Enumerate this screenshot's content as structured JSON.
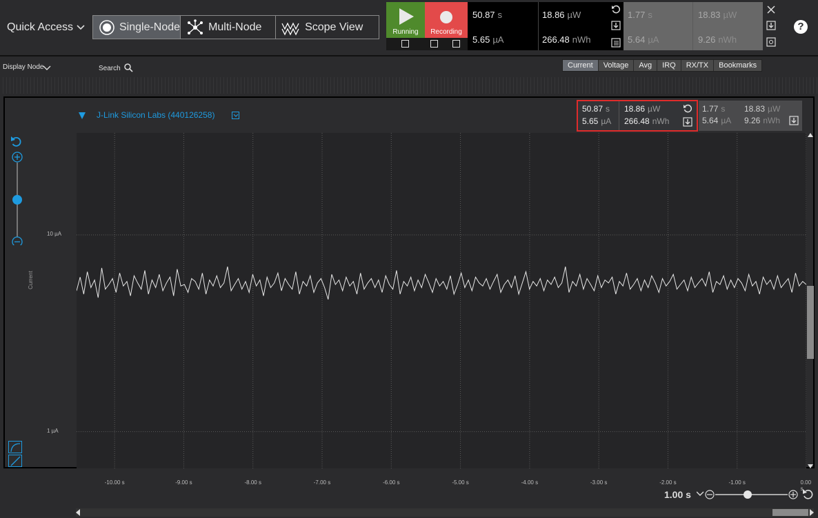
{
  "toolbar": {
    "quick_access": "Quick Access",
    "modes": [
      {
        "label": "Single-Node",
        "icon": "single-node-icon",
        "active": true
      },
      {
        "label": "Multi-Node",
        "icon": "multi-node-icon",
        "active": false
      },
      {
        "label": "Scope View",
        "icon": "scope-view-icon",
        "active": false
      }
    ],
    "running_label": "Running",
    "recording_label": "Recording",
    "help": "?"
  },
  "measurements": {
    "time": "50.87",
    "time_unit": "s",
    "current": "5.65",
    "current_unit": "µA",
    "power": "18.86",
    "power_unit": "µW",
    "energy": "266.48",
    "energy_unit": "nWh"
  },
  "measurements_selection": {
    "time": "1.77",
    "time_unit": "s",
    "current": "5.64",
    "current_unit": "µA",
    "power": "18.83",
    "power_unit": "µW",
    "energy": "9.26",
    "energy_unit": "nWh"
  },
  "bar2": {
    "display_node": "Display Node",
    "search": "Search",
    "tabs": [
      "Current",
      "Voltage",
      "Avg",
      "IRQ",
      "RX/TX",
      "Bookmarks"
    ],
    "active_tab": "Current"
  },
  "node": {
    "name": "J-Link Silicon Labs (440126258)"
  },
  "chart_data": {
    "type": "line",
    "ylabel": "Current",
    "yticks": [
      "10 µA",
      "1 µA"
    ],
    "ytick_values": [
      10,
      1
    ],
    "yscale": "log",
    "xticks": [
      "-10.00 s",
      "-9.00 s",
      "-8.00 s",
      "-7.00 s",
      "-6.00 s",
      "-5.00 s",
      "-4.00 s",
      "-3.00 s",
      "-2.00 s",
      "-1.00 s",
      "0.00 s"
    ],
    "xlim": [
      -10.55,
      0
    ],
    "ylim": [
      0.65,
      33
    ],
    "series": [
      {
        "approx_mean": 5.6,
        "values": [
          5.2,
          6.1,
          5.0,
          6.5,
          5.4,
          5.9,
          4.8,
          6.8,
          5.3,
          5.6,
          6.0,
          5.1,
          6.4,
          5.5,
          5.8,
          4.9,
          6.2,
          5.7,
          5.3,
          6.6,
          5.0,
          5.9,
          5.4,
          6.3,
          5.2,
          5.7,
          6.1,
          4.9,
          6.7,
          5.5,
          5.6,
          5.1,
          6.0,
          5.8,
          5.3,
          6.4,
          5.0,
          5.9,
          5.5,
          6.2,
          5.4,
          5.7,
          6.9,
          5.2,
          5.6,
          6.0,
          5.3,
          5.8,
          5.1,
          6.3,
          5.5,
          5.9,
          4.9,
          6.1,
          5.4,
          5.7,
          6.4,
          5.2,
          6.0,
          5.6,
          5.3,
          6.5,
          5.0,
          5.8,
          5.5,
          6.2,
          5.1,
          5.7,
          6.0,
          5.4,
          4.7,
          6.3,
          5.6,
          5.9,
          5.2,
          6.1,
          5.5,
          5.8,
          5.0,
          6.4,
          5.3,
          5.7,
          6.0,
          5.4,
          5.9,
          5.1,
          6.2,
          5.6,
          5.3,
          6.6,
          5.0,
          5.8,
          5.5,
          6.1,
          5.2,
          5.9,
          5.4,
          6.3,
          5.7,
          5.1,
          6.0,
          5.5,
          5.8,
          5.3,
          6.2,
          5.0,
          5.6,
          6.4,
          5.4,
          5.9,
          5.2,
          6.1,
          5.7,
          5.5,
          6.0,
          5.3,
          5.8,
          6.3,
          5.1,
          5.6,
          5.9,
          5.4,
          6.2,
          5.0,
          5.7,
          6.5,
          5.3,
          5.8,
          5.5,
          6.0,
          5.2,
          5.9,
          5.6,
          6.1,
          5.4,
          5.7,
          6.9,
          5.1,
          5.8,
          5.5,
          6.3,
          5.3,
          6.0,
          5.6,
          5.2,
          6.2,
          5.4,
          5.9,
          5.7,
          6.1,
          5.0,
          5.8,
          5.5,
          6.4,
          5.3,
          5.6,
          6.0,
          5.2,
          5.9,
          5.4,
          6.2,
          5.7,
          5.1,
          6.0,
          5.5,
          5.8,
          6.3,
          5.3,
          5.6,
          5.9,
          5.2,
          6.1,
          5.4,
          5.7,
          6.0,
          5.5,
          6.5,
          5.1,
          5.8,
          5.6,
          6.2,
          5.3,
          5.9,
          5.4,
          6.0,
          5.7,
          5.2,
          6.3,
          5.5,
          5.8,
          5.0,
          6.1,
          5.6,
          5.9,
          5.3,
          6.2,
          5.4,
          5.7,
          6.0,
          5.1,
          6.4,
          5.5,
          5.8,
          5.6
        ]
      }
    ]
  }
}
